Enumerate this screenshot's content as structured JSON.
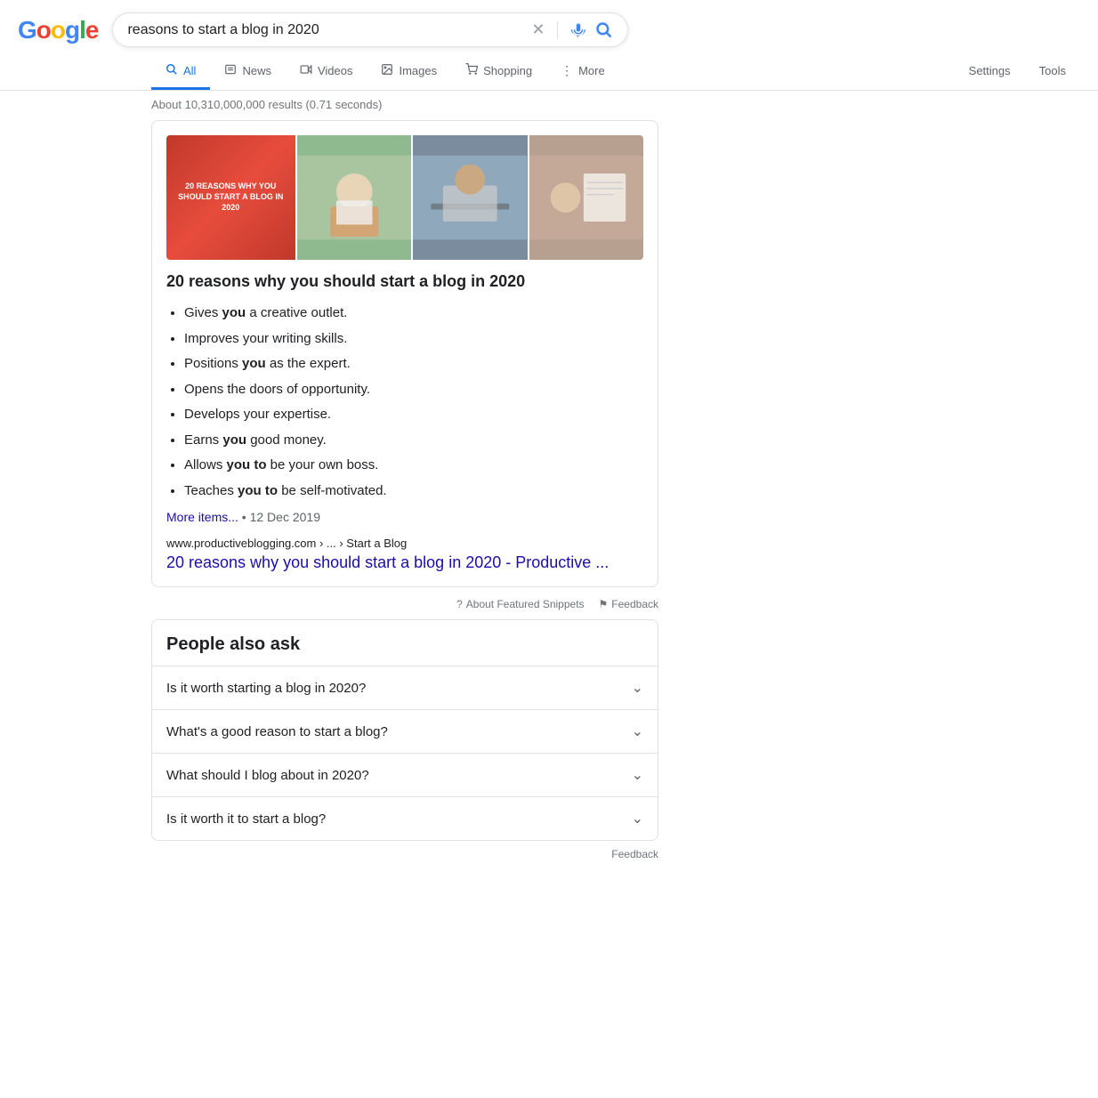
{
  "header": {
    "logo": {
      "g1": "G",
      "o1": "o",
      "o2": "o",
      "g2": "g",
      "l": "l",
      "e": "e"
    },
    "search_query": "reasons to start a blog in 2020",
    "clear_label": "×",
    "mic_label": "🎤",
    "search_label": "🔍"
  },
  "nav": {
    "tabs": [
      {
        "id": "all",
        "label": "All",
        "active": true
      },
      {
        "id": "news",
        "label": "News",
        "active": false
      },
      {
        "id": "videos",
        "label": "Videos",
        "active": false
      },
      {
        "id": "images",
        "label": "Images",
        "active": false
      },
      {
        "id": "shopping",
        "label": "Shopping",
        "active": false
      },
      {
        "id": "more",
        "label": "More",
        "active": false
      }
    ],
    "settings_label": "Settings",
    "tools_label": "Tools"
  },
  "results_info": "About 10,310,000,000 results (0.71 seconds)",
  "featured_snippet": {
    "title": "20 reasons why you should start a blog in 2020",
    "image1_text": "20 REASONS WHY YOU SHOULD START A BLOG IN 2020",
    "bullets": [
      {
        "prefix": "Gives ",
        "bold": "you",
        "suffix": " a creative outlet."
      },
      {
        "prefix": "Improves your writing skills.",
        "bold": "",
        "suffix": ""
      },
      {
        "prefix": "Positions ",
        "bold": "you",
        "suffix": " as the expert."
      },
      {
        "prefix": "Opens the doors of opportunity.",
        "bold": "",
        "suffix": ""
      },
      {
        "prefix": "Develops your expertise.",
        "bold": "",
        "suffix": ""
      },
      {
        "prefix": "Earns ",
        "bold": "you",
        "suffix": " good money."
      },
      {
        "prefix": "Allows ",
        "bold": "you to",
        "suffix": " be your own boss."
      },
      {
        "prefix": "Teaches ",
        "bold": "you to",
        "suffix": " be self-motivated."
      }
    ],
    "more_items_label": "More items...",
    "date": "12 Dec 2019",
    "source_breadcrumb": "www.productiveblogging.com › ... › Start a Blog",
    "result_link_text": "20 reasons why you should start a blog in 2020 - Productive ..."
  },
  "feedback_section": {
    "about_label": "About Featured Snippets",
    "feedback_label": "Feedback"
  },
  "people_also_ask": {
    "title": "People also ask",
    "questions": [
      "Is it worth starting a blog in 2020?",
      "What's a good reason to start a blog?",
      "What should I blog about in 2020?",
      "Is it worth it to start a blog?"
    ]
  },
  "bottom_feedback": "Feedback"
}
